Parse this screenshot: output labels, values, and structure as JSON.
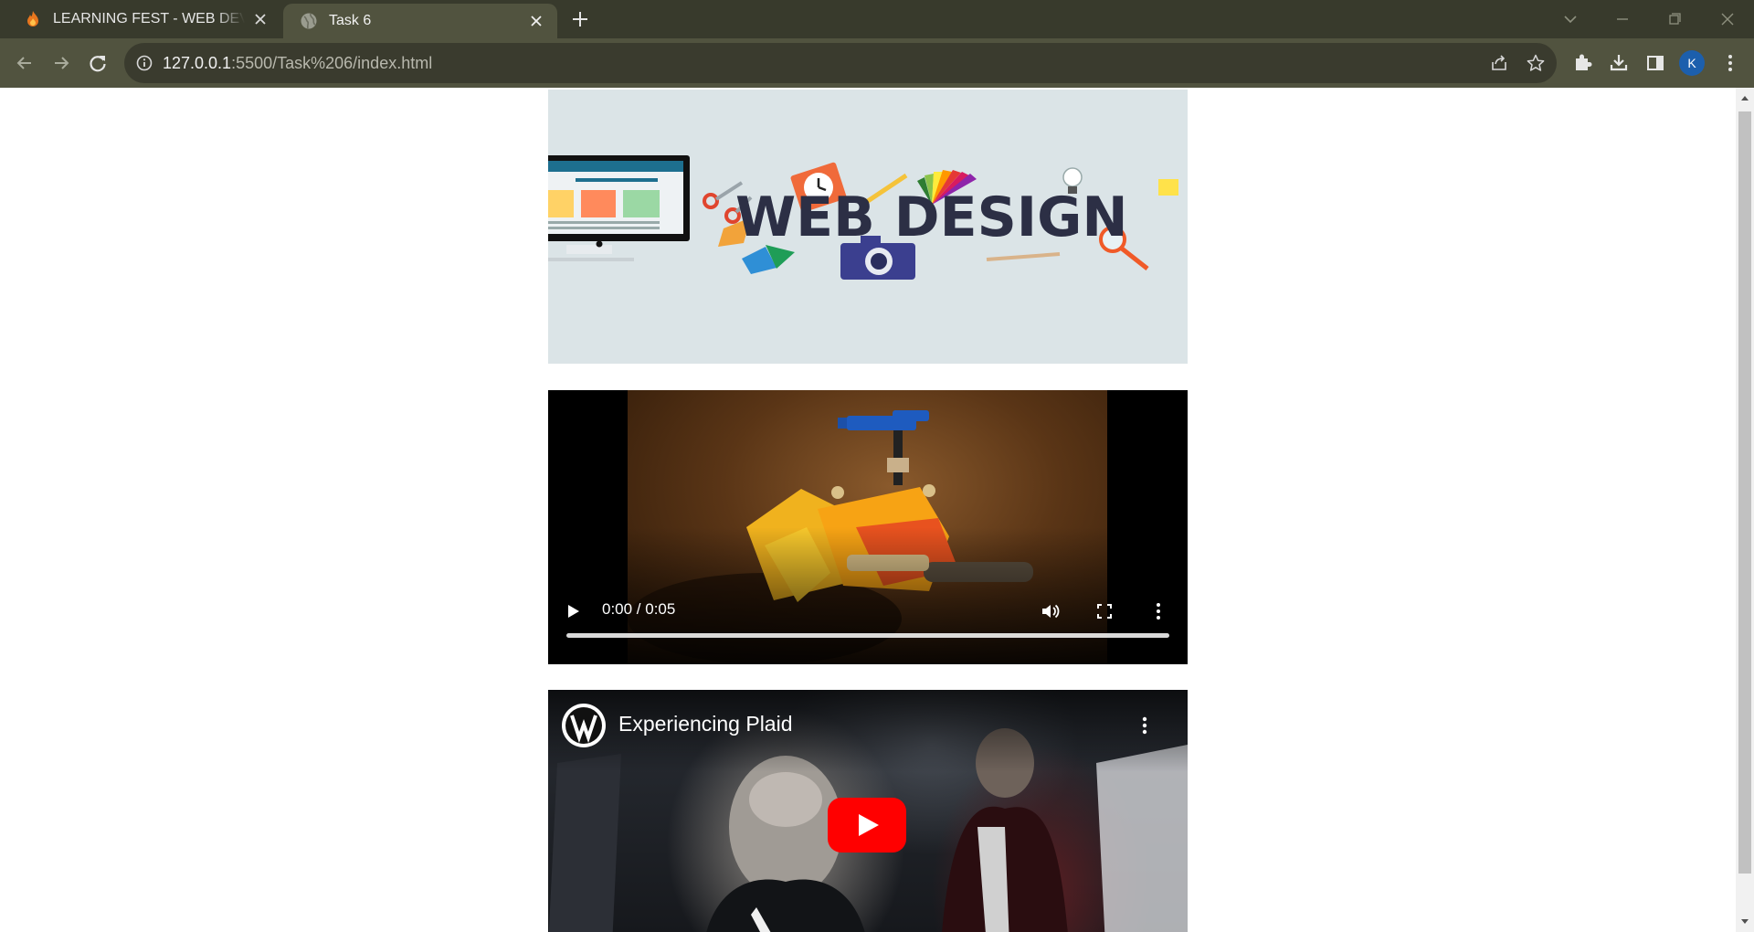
{
  "browser": {
    "tabs": [
      {
        "title": "LEARNING FEST - WEB DEVELOPMENT",
        "favicon": "fire-icon",
        "active": false
      },
      {
        "title": "Task 6",
        "favicon": "globe-icon",
        "active": true
      }
    ],
    "address": {
      "host": "127.0.0.1",
      "rest": ":5500/Task%206/index.html"
    },
    "profile_initial": "K",
    "colors": {
      "frame": "#383a2c",
      "toolbar": "#51533f",
      "omnibox": "#3a3b2e",
      "avatar": "#1c5fad"
    }
  },
  "page": {
    "banner": {
      "text": "WEB DESIGN",
      "icons": [
        "monitor-icon",
        "scissors-icon",
        "clock-icon",
        "pencil-icon",
        "color-palette-icon",
        "lightbulb-icon",
        "camera-icon",
        "magnifier-icon"
      ]
    },
    "video": {
      "time": "0:00 / 0:05",
      "progress": 0,
      "controls": [
        "play-icon",
        "volume-icon",
        "fullscreen-icon",
        "more-vert-icon"
      ]
    },
    "youtube": {
      "title": "Experiencing Plaid",
      "play_color": "#ff0000"
    }
  }
}
